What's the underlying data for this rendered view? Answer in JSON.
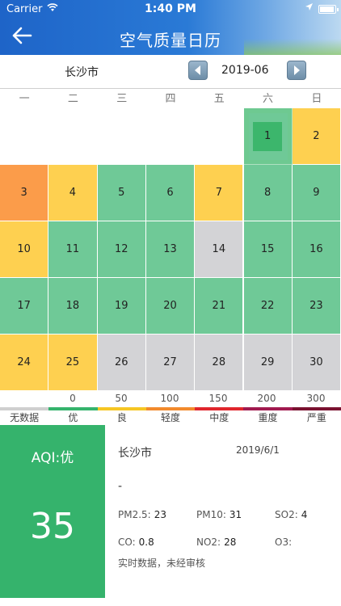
{
  "status_bar": {
    "carrier": "Carrier",
    "time": "1:40 PM"
  },
  "header": {
    "title": "空气质量日历"
  },
  "nav": {
    "city": "长沙市",
    "month": "2019-06"
  },
  "weekdays": [
    "一",
    "二",
    "三",
    "四",
    "五",
    "六",
    "日"
  ],
  "calendar": {
    "days": [
      {
        "day": "1",
        "col": 5,
        "row": 0,
        "level": "good",
        "selected": true
      },
      {
        "day": "2",
        "col": 6,
        "row": 0,
        "level": "moderate"
      },
      {
        "day": "3",
        "col": 0,
        "row": 1,
        "level": "sensitive"
      },
      {
        "day": "4",
        "col": 1,
        "row": 1,
        "level": "moderate"
      },
      {
        "day": "5",
        "col": 2,
        "row": 1,
        "level": "good"
      },
      {
        "day": "6",
        "col": 3,
        "row": 1,
        "level": "good"
      },
      {
        "day": "7",
        "col": 4,
        "row": 1,
        "level": "moderate"
      },
      {
        "day": "8",
        "col": 5,
        "row": 1,
        "level": "good"
      },
      {
        "day": "9",
        "col": 6,
        "row": 1,
        "level": "good"
      },
      {
        "day": "10",
        "col": 0,
        "row": 2,
        "level": "moderate"
      },
      {
        "day": "11",
        "col": 1,
        "row": 2,
        "level": "good"
      },
      {
        "day": "12",
        "col": 2,
        "row": 2,
        "level": "good"
      },
      {
        "day": "13",
        "col": 3,
        "row": 2,
        "level": "good"
      },
      {
        "day": "14",
        "col": 4,
        "row": 2,
        "level": "nodata"
      },
      {
        "day": "15",
        "col": 5,
        "row": 2,
        "level": "good"
      },
      {
        "day": "16",
        "col": 6,
        "row": 2,
        "level": "good"
      },
      {
        "day": "17",
        "col": 0,
        "row": 3,
        "level": "good"
      },
      {
        "day": "18",
        "col": 1,
        "row": 3,
        "level": "good"
      },
      {
        "day": "19",
        "col": 2,
        "row": 3,
        "level": "good"
      },
      {
        "day": "20",
        "col": 3,
        "row": 3,
        "level": "good"
      },
      {
        "day": "21",
        "col": 4,
        "row": 3,
        "level": "good"
      },
      {
        "day": "22",
        "col": 5,
        "row": 3,
        "level": "good"
      },
      {
        "day": "23",
        "col": 6,
        "row": 3,
        "level": "good"
      },
      {
        "day": "24",
        "col": 0,
        "row": 4,
        "level": "moderate"
      },
      {
        "day": "25",
        "col": 1,
        "row": 4,
        "level": "moderate"
      },
      {
        "day": "26",
        "col": 2,
        "row": 4,
        "level": "nodata"
      },
      {
        "day": "27",
        "col": 3,
        "row": 4,
        "level": "nodata"
      },
      {
        "day": "28",
        "col": 4,
        "row": 4,
        "level": "nodata"
      },
      {
        "day": "29",
        "col": 5,
        "row": 4,
        "level": "nodata"
      },
      {
        "day": "30",
        "col": 6,
        "row": 4,
        "level": "nodata"
      }
    ]
  },
  "level_colors": {
    "good": "#6fc997",
    "moderate": "#fed050",
    "sensitive": "#fb9c4a",
    "nodata": "#d3d3d6",
    "selected": "#35b36c"
  },
  "scale": {
    "numbers": [
      "0",
      "50",
      "100",
      "150",
      "200",
      "300"
    ],
    "labels": [
      "无数据",
      "优",
      "良",
      "轻度",
      "中度",
      "重度",
      "严重"
    ],
    "colors": [
      "#cfcfcf",
      "#35b36c",
      "#f6c623",
      "#f28a2c",
      "#e0262c",
      "#a11a4f",
      "#7a1230"
    ]
  },
  "detail": {
    "aqi_label": "AQI:优",
    "aqi_value": "35",
    "city": "长沙市",
    "date": "2019/6/1",
    "description": "-",
    "pm25_label": "PM2.5:",
    "pm25_value": "23",
    "pm10_label": "PM10:",
    "pm10_value": "31",
    "so2_label": "SO2:",
    "so2_value": "4",
    "co_label": "CO:",
    "co_value": "0.8",
    "no2_label": "NO2:",
    "no2_value": "28",
    "o3_label": "O3:",
    "o3_value": "",
    "note": "实时数据，未经审核"
  }
}
